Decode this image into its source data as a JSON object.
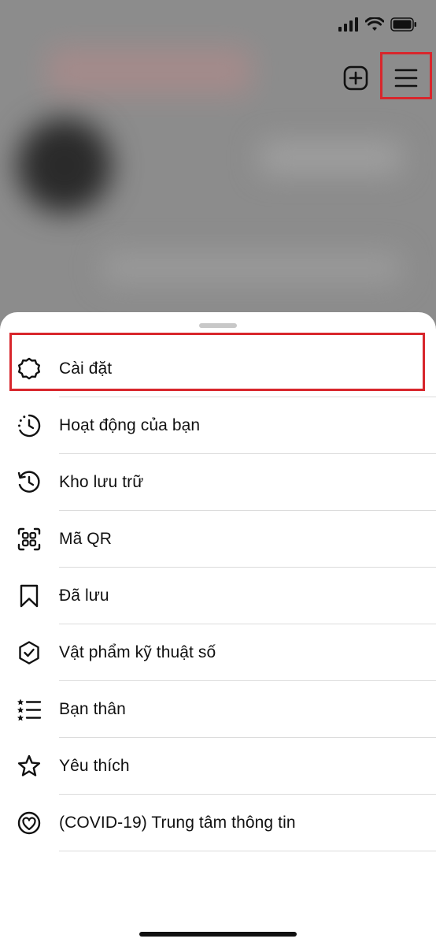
{
  "menu": {
    "items": [
      {
        "label": "Cài đặt",
        "icon": "settings-icon"
      },
      {
        "label": "Hoạt động của bạn",
        "icon": "activity-icon"
      },
      {
        "label": "Kho lưu trữ",
        "icon": "archive-icon"
      },
      {
        "label": "Mã QR",
        "icon": "qr-code-icon"
      },
      {
        "label": "Đã lưu",
        "icon": "bookmark-icon"
      },
      {
        "label": "Vật phẩm kỹ thuật số",
        "icon": "verified-shield-icon"
      },
      {
        "label": "Bạn thân",
        "icon": "close-friends-icon"
      },
      {
        "label": "Yêu thích",
        "icon": "star-icon"
      },
      {
        "label": "(COVID-19) Trung tâm thông tin",
        "icon": "covid-info-icon"
      }
    ]
  },
  "colors": {
    "highlight": "#d8262c",
    "background_dim": "#8c8c8c",
    "text": "#111111"
  }
}
